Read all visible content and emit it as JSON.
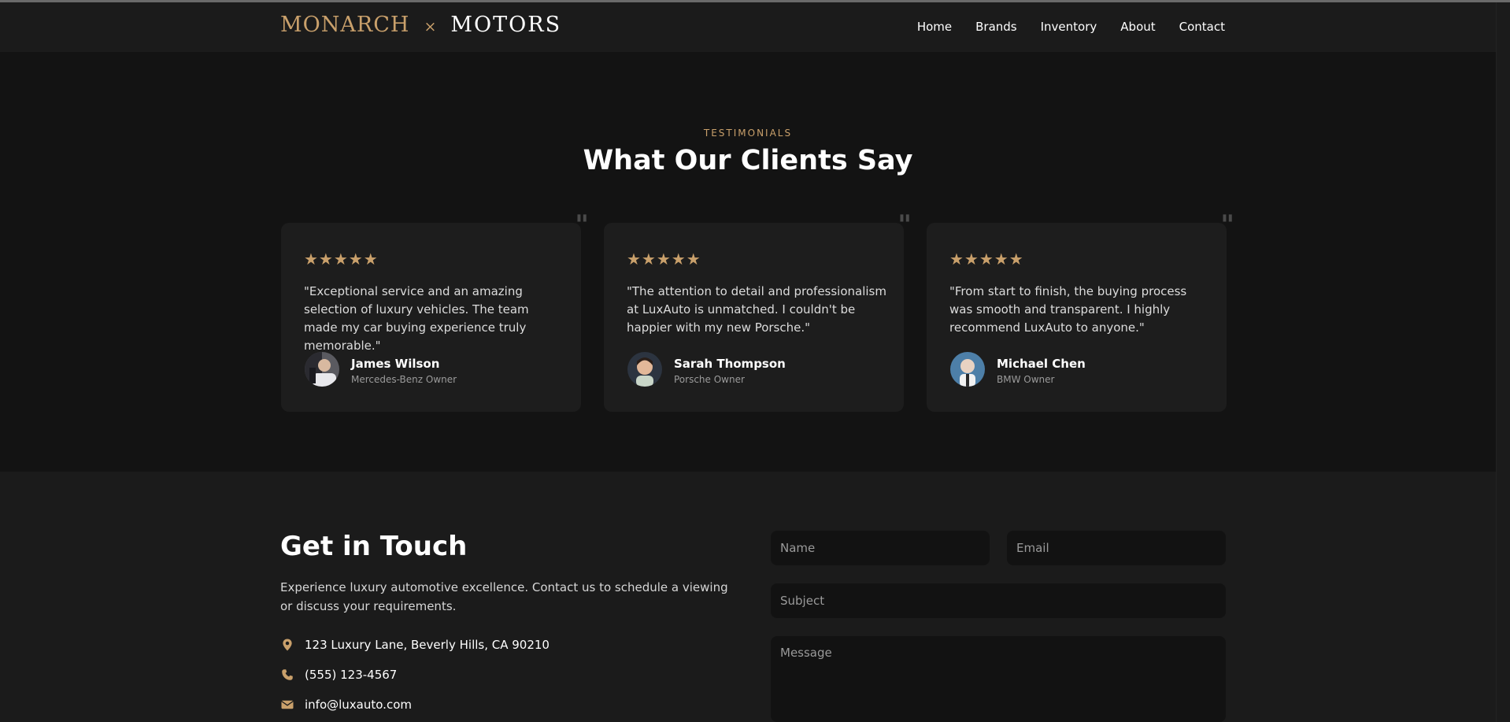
{
  "nav": {
    "logo_part1": "MONARCH",
    "logo_sep": "×",
    "logo_part2": "MOTORS",
    "links": [
      "Home",
      "Brands",
      "Inventory",
      "About",
      "Contact"
    ]
  },
  "testimonials": {
    "eyebrow": "TESTIMONIALS",
    "title": "What Our Clients Say",
    "quote_glyph": "\"",
    "cards": [
      {
        "stars": "★★★★★",
        "rating": 5,
        "text": "\"Exceptional service and an amazing selection of luxury vehicles. The team made my car buying experience truly memorable.\"",
        "name": "James Wilson",
        "role": "Mercedes-Benz Owner"
      },
      {
        "stars": "★★★★★",
        "rating": 5,
        "text": "\"The attention to detail and professionalism at LuxAuto is unmatched. I couldn't be happier with my new Porsche.\"",
        "name": "Sarah Thompson",
        "role": "Porsche Owner"
      },
      {
        "stars": "★★★★★",
        "rating": 5,
        "text": "\"From start to finish, the buying process was smooth and transparent. I highly recommend LuxAuto to anyone.\"",
        "name": "Michael Chen",
        "role": "BMW Owner"
      }
    ]
  },
  "contact": {
    "title": "Get in Touch",
    "description": "Experience luxury automotive excellence. Contact us to schedule a viewing or discuss your requirements.",
    "address": "123 Luxury Lane, Beverly Hills, CA 90210",
    "phone": "(555) 123-4567",
    "email": "info@luxauto.com",
    "form": {
      "name_placeholder": "Name",
      "email_placeholder": "Email",
      "subject_placeholder": "Subject",
      "message_placeholder": "Message"
    }
  },
  "colors": {
    "accent": "#c9a06b",
    "background": "#131313",
    "surface": "#1d1d1d"
  }
}
